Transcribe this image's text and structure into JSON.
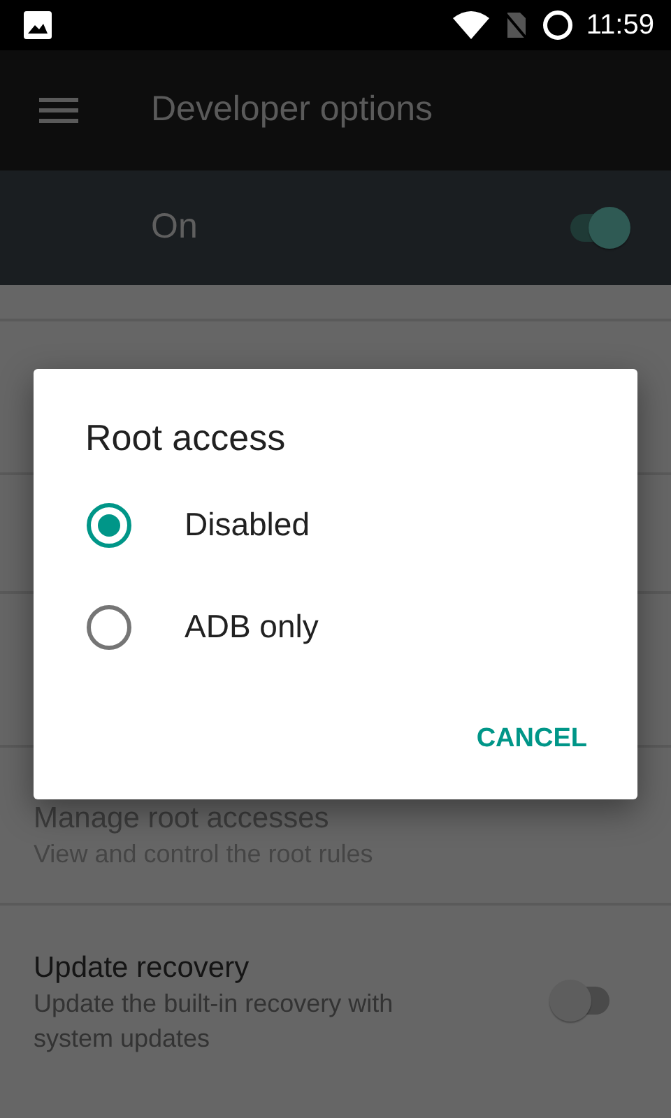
{
  "status_bar": {
    "time": "11:59"
  },
  "toolbar": {
    "title": "Developer options"
  },
  "master_switch": {
    "label": "On",
    "on": true
  },
  "settings": [
    {
      "kind": "plain",
      "title": "Manage root accesses",
      "summary": "View and control the root rules",
      "disabled": true
    },
    {
      "kind": "switch",
      "title": "Update recovery",
      "summary": "Update the built-in recovery with system updates",
      "disabled": false,
      "on": false
    }
  ],
  "dialog": {
    "title": "Root access",
    "options": [
      {
        "label": "Disabled",
        "selected": true
      },
      {
        "label": "ADB only",
        "selected": false
      }
    ],
    "buttons": [
      "CANCEL"
    ]
  }
}
